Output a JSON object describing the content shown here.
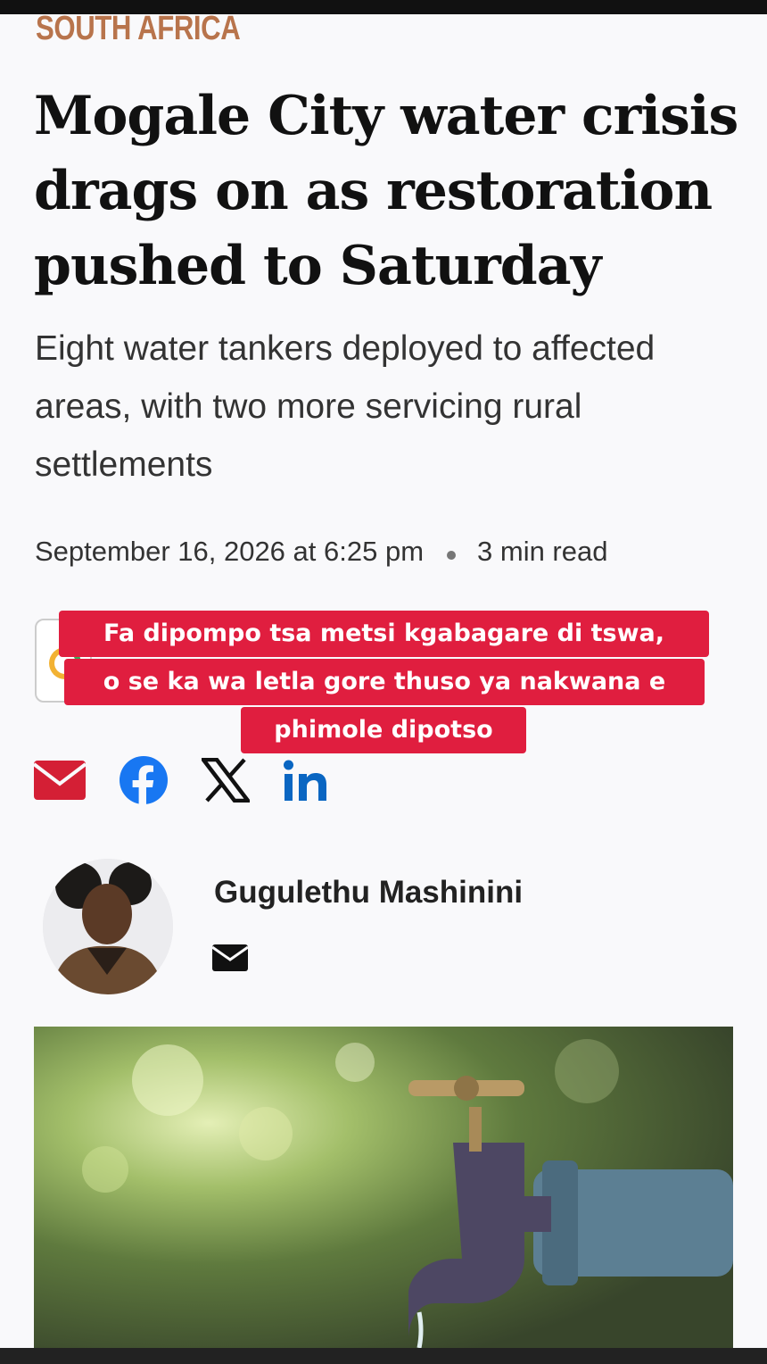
{
  "article": {
    "category": "SOUTH AFRICA",
    "headline": "Mogale City water crisis drags on as restoration pushed to Saturday",
    "subheadline": "Eight water tankers deployed to affected areas, with two more servicing rural settlements",
    "date": "September 16, 2026 at 6:25 pm",
    "read_time": "3 min read"
  },
  "caption": {
    "line1": "Fa dipompo tsa metsi kgabagare di tswa,",
    "line2": "o se ka wa letla gore thuso ya nakwana e",
    "line3": "phimole dipotso"
  },
  "share": {
    "icons": [
      "email-icon",
      "facebook-icon",
      "x-icon",
      "linkedin-icon"
    ]
  },
  "author": {
    "name": "Gugulethu Mashinini"
  },
  "colors": {
    "category": "#b8744c",
    "caption_bg": "#e01e3f",
    "email_red": "#d41f35",
    "facebook": "#1877f2",
    "linkedin": "#0a66c2"
  }
}
